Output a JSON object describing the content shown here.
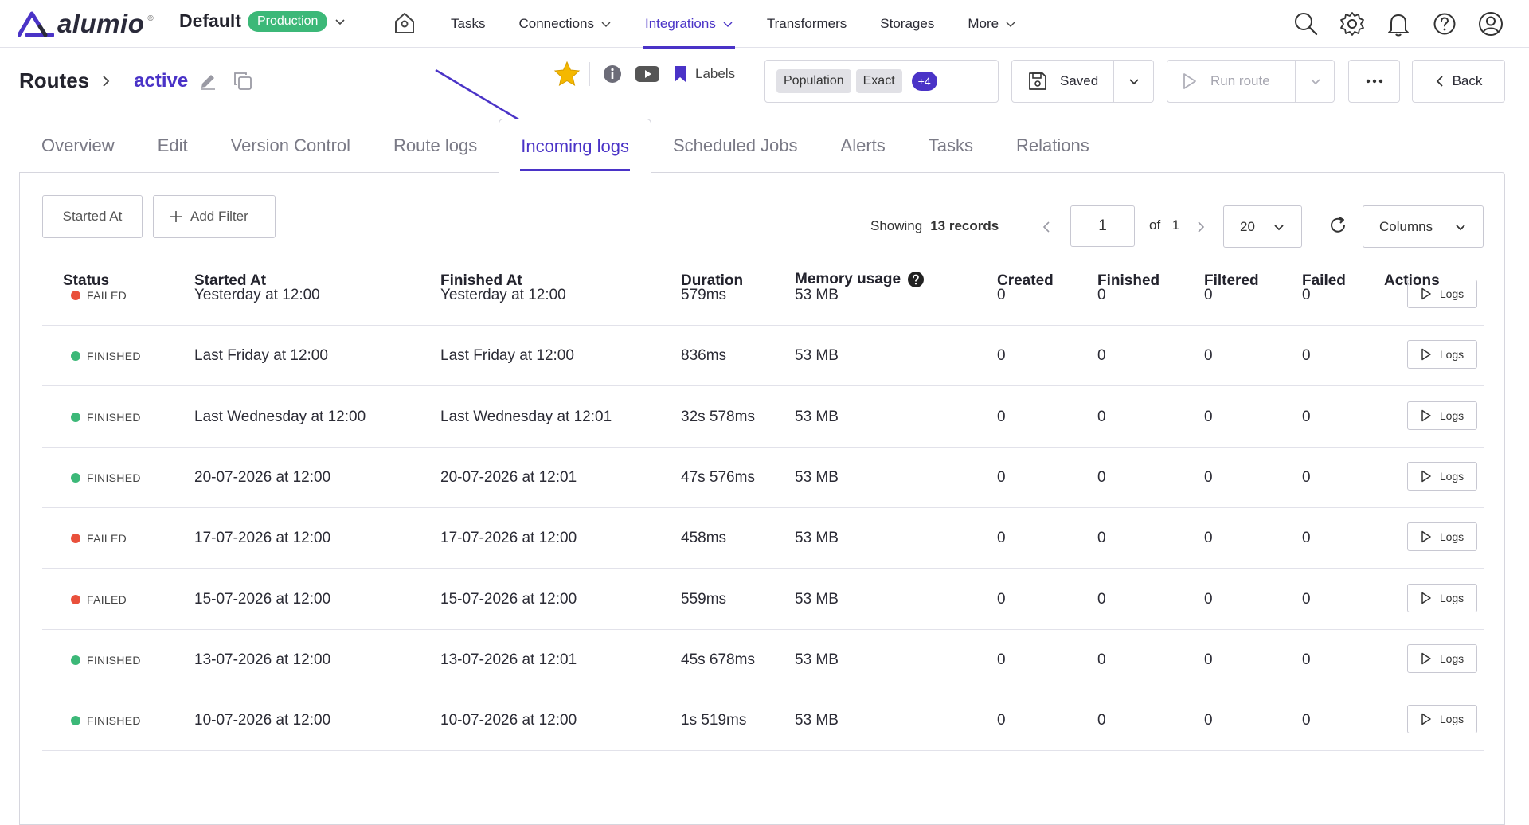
{
  "app": {
    "logo_text": "alumio",
    "logo_tm": "®",
    "workspace": "Default",
    "environment": "Production"
  },
  "nav": {
    "items": [
      {
        "label": "Tasks",
        "dropdown": false,
        "active": false
      },
      {
        "label": "Connections",
        "dropdown": true,
        "active": false
      },
      {
        "label": "Integrations",
        "dropdown": true,
        "active": true
      },
      {
        "label": "Transformers",
        "dropdown": false,
        "active": false
      },
      {
        "label": "Storages",
        "dropdown": false,
        "active": false
      },
      {
        "label": "More",
        "dropdown": true,
        "active": false
      }
    ],
    "icons": [
      "search-icon",
      "gear-icon",
      "bell-icon",
      "help-icon",
      "user-icon"
    ]
  },
  "header": {
    "breadcrumb_root": "Routes",
    "route_name": "active",
    "labels_label": "Labels",
    "labels": [
      "Population",
      "Exact"
    ],
    "labels_more": "+4",
    "saved_label": "Saved",
    "run_label": "Run route",
    "back_label": "Back"
  },
  "tabs": [
    {
      "label": "Overview",
      "active": false
    },
    {
      "label": "Edit",
      "active": false
    },
    {
      "label": "Version Control",
      "active": false
    },
    {
      "label": "Route logs",
      "active": false
    },
    {
      "label": "Incoming logs",
      "active": true
    },
    {
      "label": "Scheduled Jobs",
      "active": false
    },
    {
      "label": "Alerts",
      "active": false
    },
    {
      "label": "Tasks",
      "active": false
    },
    {
      "label": "Relations",
      "active": false
    }
  ],
  "filters": {
    "started_at": "Started At",
    "add_filter": "Add Filter"
  },
  "pagination": {
    "showing": "Showing",
    "records": "13 records",
    "page": "1",
    "of": "of",
    "total_pages": "1",
    "per_page": "20",
    "columns_label": "Columns"
  },
  "table": {
    "headers": [
      "Status",
      "Started At",
      "Finished At",
      "Duration",
      "Memory usage",
      "Created",
      "Finished",
      "Filtered",
      "Failed",
      "Actions"
    ],
    "logs_label": "Logs",
    "rows": [
      {
        "status": "FAILED",
        "started": "Yesterday at 12:00",
        "finished": "Yesterday at 12:00",
        "duration": "579ms",
        "memory": "53 MB",
        "created": "0",
        "fin": "0",
        "filtered": "0",
        "failed": "0"
      },
      {
        "status": "FINISHED",
        "started": "Last Friday at 12:00",
        "finished": "Last Friday at 12:00",
        "duration": "836ms",
        "memory": "53 MB",
        "created": "0",
        "fin": "0",
        "filtered": "0",
        "failed": "0"
      },
      {
        "status": "FINISHED",
        "started": "Last Wednesday at 12:00",
        "finished": "Last Wednesday at 12:01",
        "duration": "32s 578ms",
        "memory": "53 MB",
        "created": "0",
        "fin": "0",
        "filtered": "0",
        "failed": "0"
      },
      {
        "status": "FINISHED",
        "started": "20-07-2026 at 12:00",
        "finished": "20-07-2026 at 12:01",
        "duration": "47s 576ms",
        "memory": "53 MB",
        "created": "0",
        "fin": "0",
        "filtered": "0",
        "failed": "0"
      },
      {
        "status": "FAILED",
        "started": "17-07-2026 at 12:00",
        "finished": "17-07-2026 at 12:00",
        "duration": "458ms",
        "memory": "53 MB",
        "created": "0",
        "fin": "0",
        "filtered": "0",
        "failed": "0"
      },
      {
        "status": "FAILED",
        "started": "15-07-2026 at 12:00",
        "finished": "15-07-2026 at 12:00",
        "duration": "559ms",
        "memory": "53 MB",
        "created": "0",
        "fin": "0",
        "filtered": "0",
        "failed": "0"
      },
      {
        "status": "FINISHED",
        "started": "13-07-2026 at 12:00",
        "finished": "13-07-2026 at 12:01",
        "duration": "45s 678ms",
        "memory": "53 MB",
        "created": "0",
        "fin": "0",
        "filtered": "0",
        "failed": "0"
      },
      {
        "status": "FINISHED",
        "started": "10-07-2026 at 12:00",
        "finished": "10-07-2026 at 12:00",
        "duration": "1s 519ms",
        "memory": "53 MB",
        "created": "0",
        "fin": "0",
        "filtered": "0",
        "failed": "0"
      }
    ]
  },
  "colors": {
    "accent": "#4a33c7",
    "production": "#3cb878",
    "finished": "#3cb878",
    "failed": "#e9503b",
    "star": "#f5b800"
  }
}
